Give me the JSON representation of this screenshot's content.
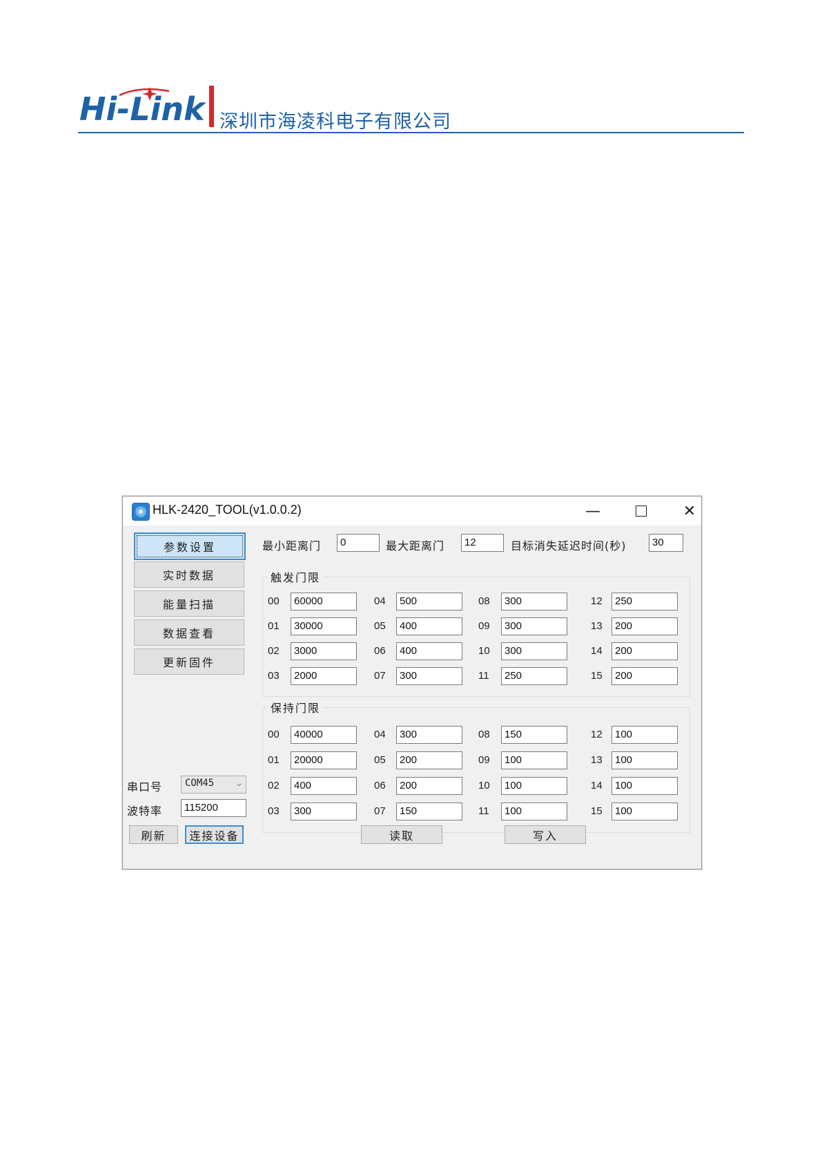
{
  "header": {
    "company_name": "深圳市海凌科电子有限公司",
    "logo_text": "Hi-Link",
    "colors": {
      "brand_blue": "#1e62a8",
      "brand_red": "#d42a2a"
    }
  },
  "window": {
    "title": "HLK-2420_TOOL(v1.0.0.2)",
    "controls": {
      "minimize": "—",
      "close": "✕"
    }
  },
  "nav": {
    "buttons": [
      "参数设置",
      "实时数据",
      "能量扫描",
      "数据查看",
      "更新固件"
    ],
    "active": "参数设置"
  },
  "params": {
    "min_gate_label": "最小距离门",
    "min_gate_value": "0",
    "max_gate_label": "最大距离门",
    "max_gate_value": "12",
    "delay_label": "目标消失延迟时间(秒)",
    "delay_value": "30"
  },
  "trigger": {
    "title": "触发门限",
    "gates": [
      {
        "idx": "00",
        "val": "60000"
      },
      {
        "idx": "01",
        "val": "30000"
      },
      {
        "idx": "02",
        "val": "3000"
      },
      {
        "idx": "03",
        "val": "2000"
      },
      {
        "idx": "04",
        "val": "500"
      },
      {
        "idx": "05",
        "val": "400"
      },
      {
        "idx": "06",
        "val": "400"
      },
      {
        "idx": "07",
        "val": "300"
      },
      {
        "idx": "08",
        "val": "300"
      },
      {
        "idx": "09",
        "val": "300"
      },
      {
        "idx": "10",
        "val": "300"
      },
      {
        "idx": "11",
        "val": "250"
      },
      {
        "idx": "12",
        "val": "250"
      },
      {
        "idx": "13",
        "val": "200"
      },
      {
        "idx": "14",
        "val": "200"
      },
      {
        "idx": "15",
        "val": "200"
      }
    ]
  },
  "hold": {
    "title": "保持门限",
    "gates": [
      {
        "idx": "00",
        "val": "40000"
      },
      {
        "idx": "01",
        "val": "20000"
      },
      {
        "idx": "02",
        "val": "400"
      },
      {
        "idx": "03",
        "val": "300"
      },
      {
        "idx": "04",
        "val": "300"
      },
      {
        "idx": "05",
        "val": "200"
      },
      {
        "idx": "06",
        "val": "200"
      },
      {
        "idx": "07",
        "val": "150"
      },
      {
        "idx": "08",
        "val": "150"
      },
      {
        "idx": "09",
        "val": "100"
      },
      {
        "idx": "10",
        "val": "100"
      },
      {
        "idx": "11",
        "val": "100"
      },
      {
        "idx": "12",
        "val": "100"
      },
      {
        "idx": "13",
        "val": "100"
      },
      {
        "idx": "14",
        "val": "100"
      },
      {
        "idx": "15",
        "val": "100"
      }
    ]
  },
  "serial": {
    "port_label": "串口号",
    "port_value": "COM45",
    "baud_label": "波特率",
    "baud_value": "115200",
    "refresh_label": "刷新",
    "connect_label": "连接设备"
  },
  "actions": {
    "read_label": "读取",
    "write_label": "写入"
  }
}
